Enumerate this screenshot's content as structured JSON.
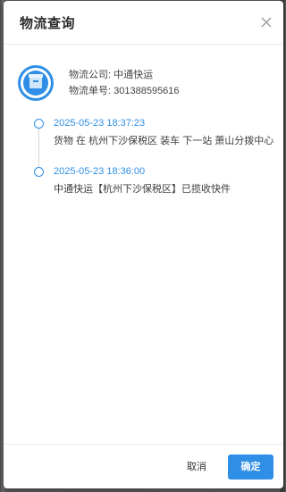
{
  "modal": {
    "title": "物流查询",
    "close_icon": "close-icon"
  },
  "carrier": {
    "icon": "package-icon",
    "company_label": "物流公司:",
    "company_value": "中通快运",
    "tracking_label": "物流单号:",
    "tracking_value": "301388595616"
  },
  "timeline": [
    {
      "time": "2025-05-23 18:37:23",
      "description": "货物 在 杭州下沙保税区 装车 下一站 萧山分拨中心"
    },
    {
      "time": "2025-05-23 18:36:00",
      "description": "中通快运【杭州下沙保税区】已揽收快件"
    }
  ],
  "footer": {
    "cancel_label": "取消",
    "confirm_label": "确定"
  },
  "colors": {
    "accent": "#2f8fe6",
    "text": "#3d3d3d"
  }
}
